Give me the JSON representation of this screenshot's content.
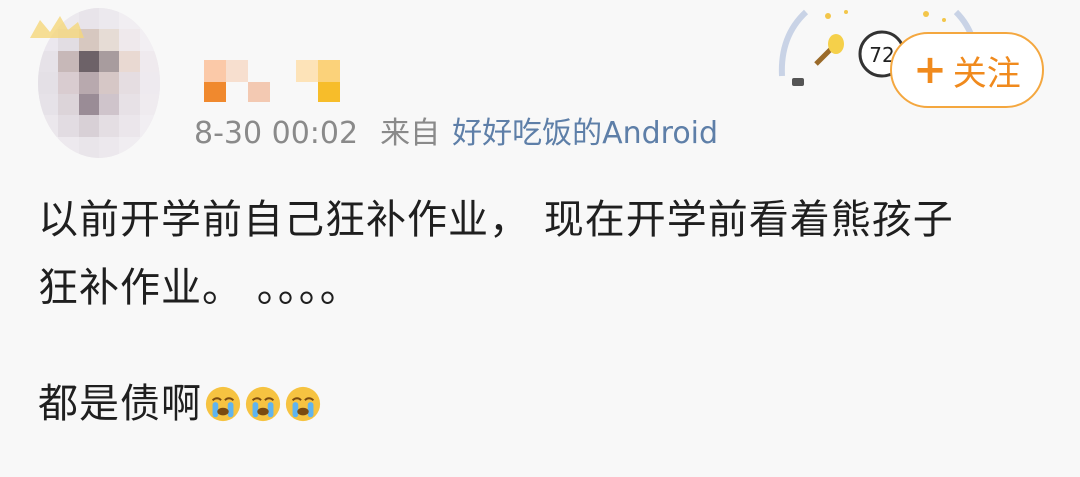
{
  "post": {
    "timestamp": "8-30 00:02",
    "source_prefix": "来自",
    "source_device": "好好吃饭的Android",
    "badge_number": "72",
    "follow_plus": "+",
    "follow_label": "关注",
    "content_line1": "以前开学前自己狂补作业， 现在开学前看着熊孩子",
    "content_line2": "狂补作业。 。。。。",
    "content_line3": "都是债啊",
    "emojis": [
      "crying-face-icon",
      "crying-face-icon",
      "crying-face-icon"
    ]
  },
  "colors": {
    "accent": "#f08a1d",
    "link": "#5e7fa8",
    "text": "#1f1f1f",
    "meta": "#8a8a8a"
  }
}
